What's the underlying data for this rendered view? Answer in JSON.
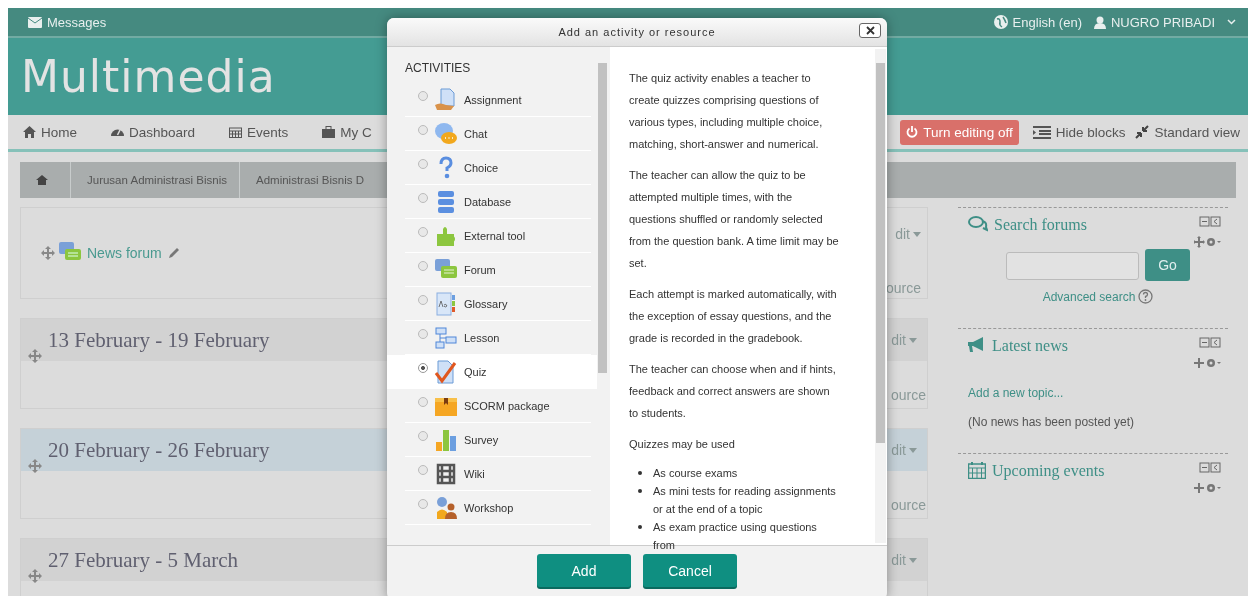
{
  "topbar": {
    "messages": "Messages",
    "language": "English (en)",
    "user": "NUGRO PRIBADI"
  },
  "site_title": "Multimedia",
  "nav": {
    "items": [
      "Home",
      "Dashboard",
      "Events",
      "My C"
    ],
    "edit_button": "Turn editing off",
    "hide_blocks": "Hide blocks",
    "standard_view": "Standard view"
  },
  "breadcrumb": [
    "Jurusan Administrasi Bisnis",
    "Administrasi Bisnis D"
  ],
  "news_section": {
    "link": "News forum",
    "edit": "dit",
    "resource": "ource"
  },
  "sections": [
    {
      "title": "13 February - 19 February",
      "highlighted": false,
      "edit": "dit",
      "resource": "ource"
    },
    {
      "title": "20 February - 26 February",
      "highlighted": true,
      "edit": "dit",
      "resource": "ource"
    },
    {
      "title": "27 February - 5 March",
      "highlighted": false,
      "edit": "dit"
    }
  ],
  "blocks": {
    "search_forums": {
      "title": "Search forums",
      "button": "Go",
      "advanced": "Advanced search"
    },
    "latest_news": {
      "title": "Latest news",
      "add": "Add a new topic...",
      "empty": "(No news has been posted yet)"
    },
    "upcoming_events": {
      "title": "Upcoming events"
    }
  },
  "modal": {
    "title": "Add an activity or resource",
    "heading": "ACTIVITIES",
    "options": [
      {
        "label": "Assignment",
        "selected": false
      },
      {
        "label": "Chat",
        "selected": false
      },
      {
        "label": "Choice",
        "selected": false
      },
      {
        "label": "Database",
        "selected": false
      },
      {
        "label": "External tool",
        "selected": false
      },
      {
        "label": "Forum",
        "selected": false
      },
      {
        "label": "Glossary",
        "selected": false
      },
      {
        "label": "Lesson",
        "selected": false
      },
      {
        "label": "Quiz",
        "selected": true
      },
      {
        "label": "SCORM package",
        "selected": false
      },
      {
        "label": "Survey",
        "selected": false
      },
      {
        "label": "Wiki",
        "selected": false
      },
      {
        "label": "Workshop",
        "selected": false
      }
    ],
    "paragraphs": [
      "The quiz activity enables a teacher to create quizzes comprising questions of various types, including multiple choice, matching, short-answer and numerical.",
      "The teacher can allow the quiz to be attempted multiple times, with the questions shuffled or randomly selected from the question bank. A time limit may be set.",
      "Each attempt is marked automatically, with the exception of essay questions, and the grade is recorded in the gradebook.",
      "The teacher can choose when and if hints, feedback and correct answers are shown to students.",
      "Quizzes may be used"
    ],
    "bullets": [
      "As course exams",
      "As mini tests for reading assignments or at the end of a topic",
      "As exam practice using questions from"
    ],
    "add_button": "Add",
    "cancel_button": "Cancel"
  }
}
